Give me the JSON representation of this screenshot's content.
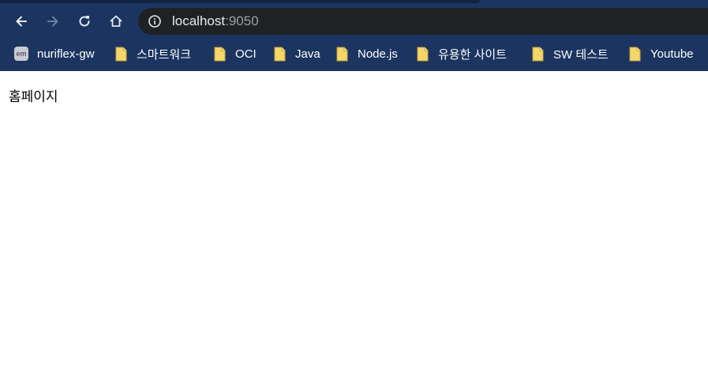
{
  "colors": {
    "chrome_background": "#1c3560",
    "omnibox_background": "#202124",
    "bookmark_text": "#ffffff",
    "folder_icon": "#f5d66b"
  },
  "toolbar": {
    "back_icon": "arrow-left",
    "forward_icon": "arrow-right",
    "reload_icon": "reload",
    "home_icon": "home",
    "site_info_icon": "info-circle"
  },
  "omnibox": {
    "url_host": "localhost",
    "url_port": ":9050"
  },
  "bookmarks": [
    {
      "label": "nuriflex-gw",
      "icon": "em-favicon"
    },
    {
      "label": "스마트워크",
      "icon": "folder"
    },
    {
      "label": "OCI",
      "icon": "folder"
    },
    {
      "label": "Java",
      "icon": "folder"
    },
    {
      "label": "Node.js",
      "icon": "folder"
    },
    {
      "label": "유용한 사이트",
      "icon": "folder"
    },
    {
      "label": "SW 테스트",
      "icon": "folder"
    },
    {
      "label": "Youtube",
      "icon": "folder"
    }
  ],
  "favicon_text": "em",
  "page": {
    "text": "홈페이지"
  }
}
